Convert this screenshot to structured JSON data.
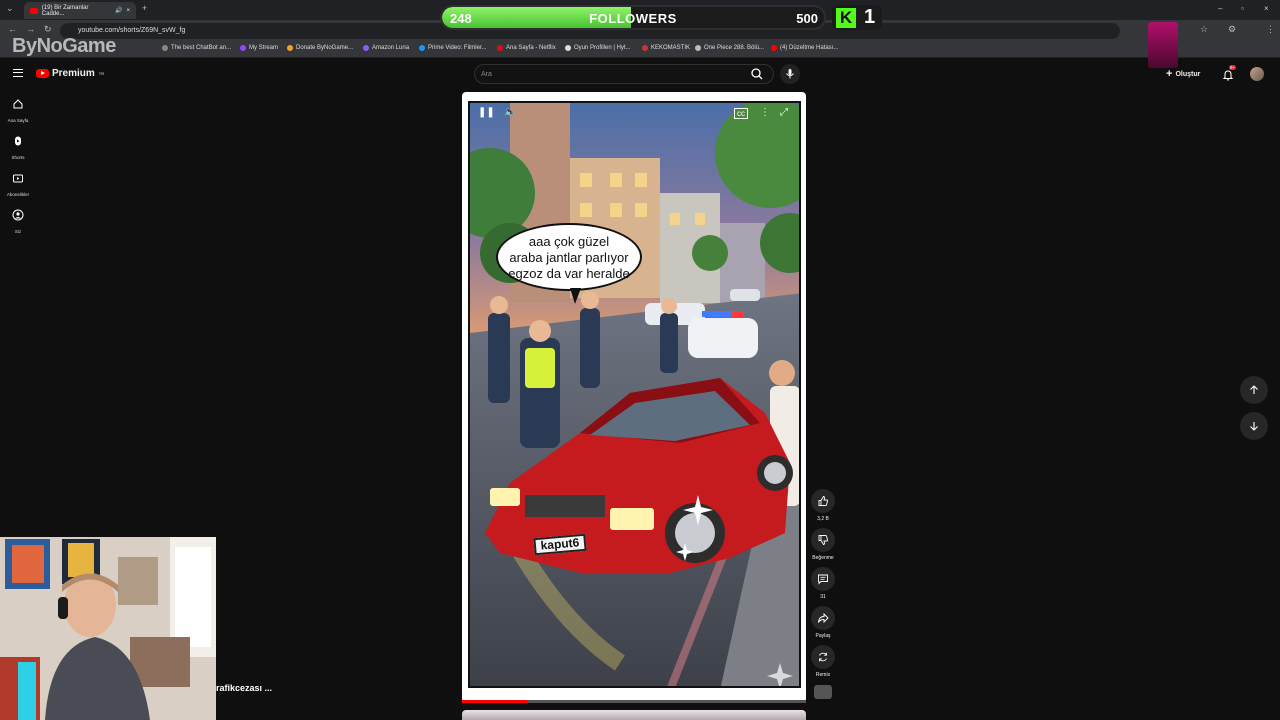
{
  "browser": {
    "tab_title": "(19) Bir Zamanlar Cadde...",
    "url": "youtube.com/shorts/Z69N_svW_fg",
    "bookmarks": [
      "The best ChatBot an...",
      "My Stream",
      "Donate ByNoGame...",
      "Amazon Luna",
      "Prime Video: Filmler...",
      "Ana Sayfa - Netflix",
      "Oyun Profillen | Hyt...",
      "KEKOMASTIK",
      "One Piece 288. Bölü...",
      "(4) Düzeltme Hatası..."
    ]
  },
  "stream_overlay": {
    "followers_current": "248",
    "followers_label": "FOLLOWERS",
    "followers_goal": "500",
    "followers_progress": 0.496,
    "kick_logo": "K",
    "kick_count": "1",
    "watermark": "ByNoGame",
    "webcam_overlay_text": "rafikcezası ..."
  },
  "youtube": {
    "logo_text": "Premium",
    "logo_region": "TR",
    "search_placeholder": "Ara",
    "create_label": "Oluştur",
    "notification_badge": "9+",
    "guide": [
      {
        "label": "Ana Sayfa",
        "icon": "home-icon"
      },
      {
        "label": "Shorts",
        "icon": "shorts-icon"
      },
      {
        "label": "Abonelikler",
        "icon": "subscriptions-icon"
      },
      {
        "label": "Siz",
        "icon": "you-icon"
      }
    ]
  },
  "short": {
    "comic_text_lines": [
      "aaa çok güzel",
      "araba jantlar parlıyor",
      "egzoz da var heralde"
    ],
    "plate_text": "kaput6",
    "progress": 0.19,
    "actions": {
      "like_count": "3,2 B",
      "dislike_label": "Beğenme",
      "comments_count": "31",
      "share_label": "Paylaş",
      "remix_label": "Remix"
    }
  },
  "colors": {
    "accent_red": "#ff0000",
    "kick_green": "#53fc18",
    "followers_bar": "#48c331",
    "background": "#0f0f0f"
  }
}
